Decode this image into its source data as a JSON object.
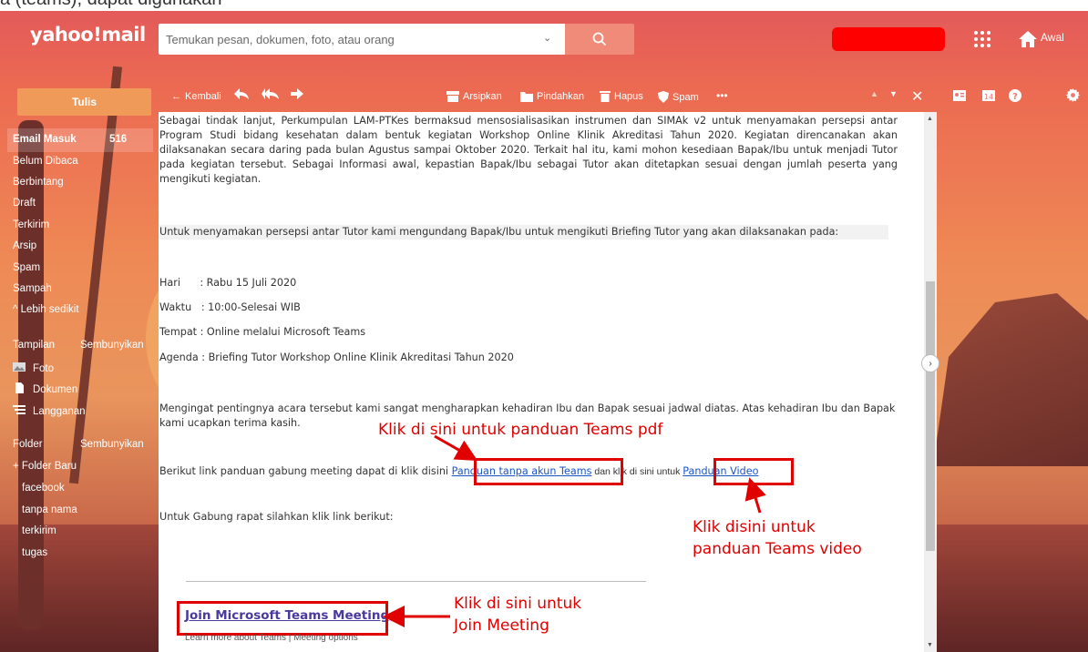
{
  "top_fragment": "a (teams), dapat digunakan",
  "header": {
    "logo": "yahoo!mail",
    "search_placeholder": "Temukan pesan, dokumen, foto, atau orang",
    "home_label": "Awal"
  },
  "sidebar": {
    "compose": "Tulis",
    "items": [
      {
        "label": "Email Masuk",
        "count": "516"
      },
      {
        "label": "Belum Dibaca"
      },
      {
        "label": "Berbintang"
      },
      {
        "label": "Draft"
      },
      {
        "label": "Terkirim"
      },
      {
        "label": "Arsip"
      },
      {
        "label": "Spam"
      },
      {
        "label": "Sampah"
      }
    ],
    "less": "^ Lebih sedikit",
    "views_label": "Tampilan",
    "views_hide": "Sembunyikan",
    "views": [
      "Foto",
      "Dokumen",
      "Langganan"
    ],
    "folder_label": "Folder",
    "folder_hide": "Sembunyikan",
    "new_folder": "+ Folder Baru",
    "folders": [
      "facebook",
      "tanpa nama",
      "terkirim",
      "tugas"
    ]
  },
  "toolbar": {
    "back": "Kembali",
    "archive": "Arsipkan",
    "move": "Pindahkan",
    "delete": "Hapus",
    "spam": "Spam",
    "more": "•••"
  },
  "message": {
    "para1": "Sebagai tindak lanjut, Perkumpulan LAM-PTKes bermaksud mensosialisasikan instrumen dan SIMAk v2 untuk menyamakan persepsi antar Program Studi bidang kesehatan dalam bentuk kegiatan Workshop Online Klinik Akreditasi Tahun 2020. Kegiatan direncanakan akan dilaksanakan secara daring pada bulan Agustus sampai Oktober 2020. Terkait hal itu, kami mohon kesediaan Bapak/Ibu untuk menjadi Tutor pada kegiatan tersebut. Sebagai Informasi awal, kepastian Bapak/Ibu sebagai Tutor akan ditetapkan sesuai dengan jumlah peserta yang mengikuti kegiatan.",
    "para2": "Untuk menyamakan persepsi antar Tutor kami mengundang Bapak/Ibu untuk mengikuti Briefing Tutor yang akan dilaksanakan pada:",
    "hari": "Hari      : Rabu 15 Juli 2020",
    "waktu": "Waktu   : 10:00-Selesai WIB",
    "tempat": "Tempat : Online melalui Microsoft Teams",
    "agenda": "Agenda : Briefing Tutor Workshop Online Klinik Akreditasi Tahun 2020",
    "para3": "Mengingat pentingnya acara tersebut kami sangat mengharapkan kehadiran Ibu dan Bapak sesuai jadwal diatas. Atas kehadiran Ibu dan Bapak kami ucapkan terima kasih.",
    "link_intro": "Berikut link panduan gabung meeting dapat di klik disini ",
    "link1": "Panduan tanpa akun Teams",
    "link_mid": " dan klik di sini untuk ",
    "link2": "Panduan Video",
    "join_intro": "Untuk Gabung rapat silahkan klik link berikut:",
    "join_link": "Join Microsoft Teams Meeting",
    "learn_more": "Learn more about Teams",
    "separator": " | ",
    "meeting_options": "Meeting options"
  },
  "annotations": {
    "pdf": "Klik di sini untuk panduan Teams pdf",
    "video_line1": "Klik disini untuk",
    "video_line2": "panduan Teams video",
    "join_line1": "Klik di sini untuk",
    "join_line2": "Join Meeting"
  },
  "colors": {
    "accent": "#f09a5a",
    "annotation": "#e00000",
    "link": "#1a55c8"
  }
}
